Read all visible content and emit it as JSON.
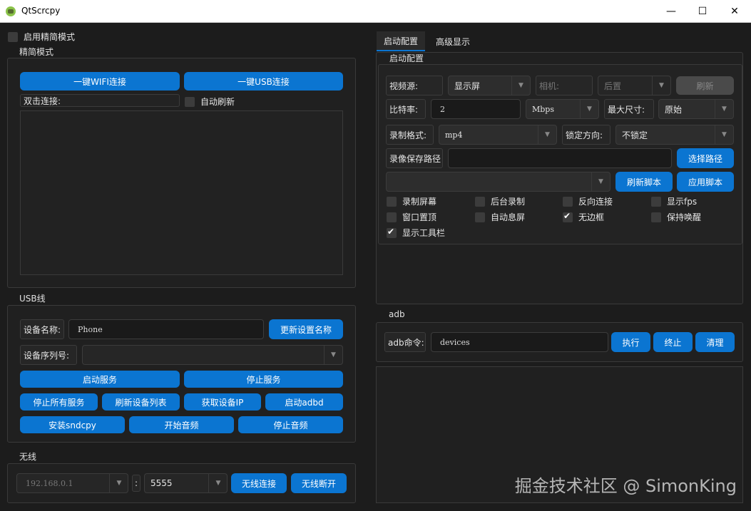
{
  "window": {
    "title": "QtScrcpy",
    "minimize": "—",
    "maximize": "☐",
    "close": "✕"
  },
  "simple_mode": {
    "checkbox_label": "启用精简模式",
    "group_title": "精简模式",
    "wifi_btn": "一键WIFI连接",
    "usb_btn": "一键USB连接",
    "double_click_label": "双击连接:",
    "auto_refresh_label": "自动刷新"
  },
  "usb": {
    "group_title": "USB线",
    "device_name_label": "设备名称:",
    "device_name_value": "Phone",
    "update_name_btn": "更新设置名称",
    "serial_label": "设备序列号:",
    "start_server": "启动服务",
    "stop_server": "停止服务",
    "stop_all": "停止所有服务",
    "refresh_devices": "刷新设备列表",
    "get_ip": "获取设备IP",
    "start_adbd": "启动adbd",
    "install_sndcpy": "安装sndcpy",
    "start_audio": "开始音频",
    "stop_audio": "停止音频"
  },
  "wireless": {
    "group_title": "无线",
    "ip_value": "192.168.0.1",
    "port_value": "5555",
    "connect_btn": "无线连接",
    "disconnect_btn": "无线断开",
    "separator": ":"
  },
  "tabs": [
    {
      "label": "启动配置"
    },
    {
      "label": "高级显示"
    }
  ],
  "config": {
    "group_title": "启动配置",
    "video_source_label": "视频源:",
    "video_source_value": "显示屏",
    "camera_label": "相机:",
    "camera_value": "后置",
    "refresh_btn": "刷新",
    "bitrate_label": "比特率:",
    "bitrate_value": "2",
    "bitrate_unit": "Mbps",
    "max_size_label": "最大尺寸:",
    "max_size_value": "原始",
    "record_format_label": "录制格式:",
    "record_format_value": "mp4",
    "lock_orientation_label": "锁定方向:",
    "lock_orientation_value": "不锁定",
    "record_path_label": "录像保存路径",
    "select_path_btn": "选择路径",
    "refresh_script_btn": "刷新脚本",
    "apply_script_btn": "应用脚本",
    "checks": {
      "record_screen": "录制屏幕",
      "background_record": "后台录制",
      "reverse_connect": "反向连接",
      "show_fps": "显示fps",
      "window_top": "窗口置顶",
      "auto_off_screen": "自动息屏",
      "frameless": "无边框",
      "stay_awake": "保持唤醒",
      "show_toolbar": "显示工具栏"
    }
  },
  "adb": {
    "group_title": "adb",
    "cmd_label": "adb命令:",
    "cmd_value": "devices",
    "execute_btn": "执行",
    "stop_btn": "终止",
    "clear_btn": "清理"
  },
  "watermark": "掘金技术社区 @ SimonKing",
  "icons": {
    "app": "android-icon",
    "arrow": "chevron-down-icon"
  }
}
